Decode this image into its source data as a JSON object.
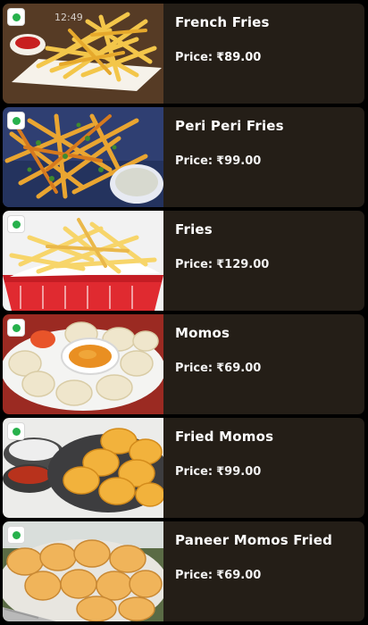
{
  "status_bar": {
    "time": "12:49"
  },
  "price_label": "Price:",
  "menu_items": [
    {
      "name": "French Fries",
      "price": "₹89.00",
      "veg_icon": "veg-indicator-icon"
    },
    {
      "name": "Peri Peri Fries",
      "price": "₹99.00",
      "veg_icon": "veg-indicator-icon"
    },
    {
      "name": "Fries",
      "price": "₹129.00",
      "veg_icon": "veg-indicator-icon"
    },
    {
      "name": "Momos",
      "price": "₹69.00",
      "veg_icon": "veg-indicator-icon"
    },
    {
      "name": "Fried Momos",
      "price": "₹99.00",
      "veg_icon": "veg-indicator-icon"
    },
    {
      "name": "Paneer Momos Fried",
      "price": "₹69.00",
      "veg_icon": "veg-indicator-icon"
    }
  ],
  "colors": {
    "page_background": "#000000",
    "card_background": "#241e17",
    "text": "#ffffff",
    "veg_green": "#27b14c"
  }
}
